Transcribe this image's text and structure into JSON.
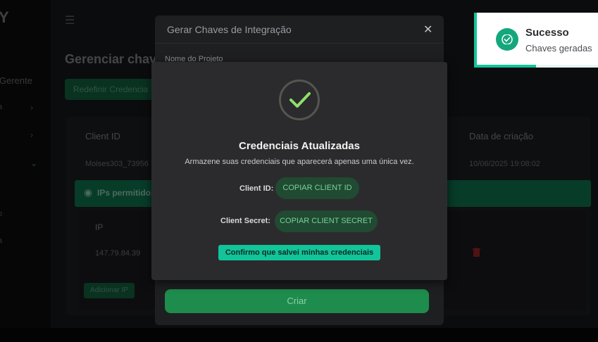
{
  "app": {
    "logo_fragment": "Y",
    "nav_label": "Gerente",
    "nav_frag_a": "a",
    "nav_frag_b": "o",
    "nav_frag_c": "a",
    "page_title": "Gerenciar chav",
    "reset_button": "Redefinir Credencia",
    "table": {
      "col_client_id": "Client ID",
      "col_created": "Data de criação",
      "client_id_value": "Moises303_73956",
      "created_value": "10/06/2025 19:08:02"
    },
    "ips": {
      "section_label": "IPs permitidos",
      "col_ip": "IP",
      "ip_value": "147.79.84.39",
      "add_button": "Adicionar IP"
    }
  },
  "modal": {
    "title": "Gerar Chaves de Integração",
    "close_glyph": "✕",
    "field_label": "Nome do Projeto",
    "create_button": "Criar"
  },
  "credentials": {
    "title": "Credenciais Atualizadas",
    "subtitle": "Armazene suas credenciais que aparecerá apenas uma única vez.",
    "client_id_label": "Client ID:",
    "copy_client_id": "COPIAR CLIENT ID",
    "client_secret_label": "Client Secret:",
    "copy_client_secret": "COPIAR CLIENT SECRET",
    "confirm_button": "Confirmo que salvei minhas credenciais"
  },
  "toast": {
    "title": "Sucesso",
    "message": "Chaves geradas",
    "progress_fraction": 0.49
  },
  "colors": {
    "accent": "#13c49a",
    "primary_green": "#1e8c4c",
    "danger": "#7a1d1d"
  }
}
